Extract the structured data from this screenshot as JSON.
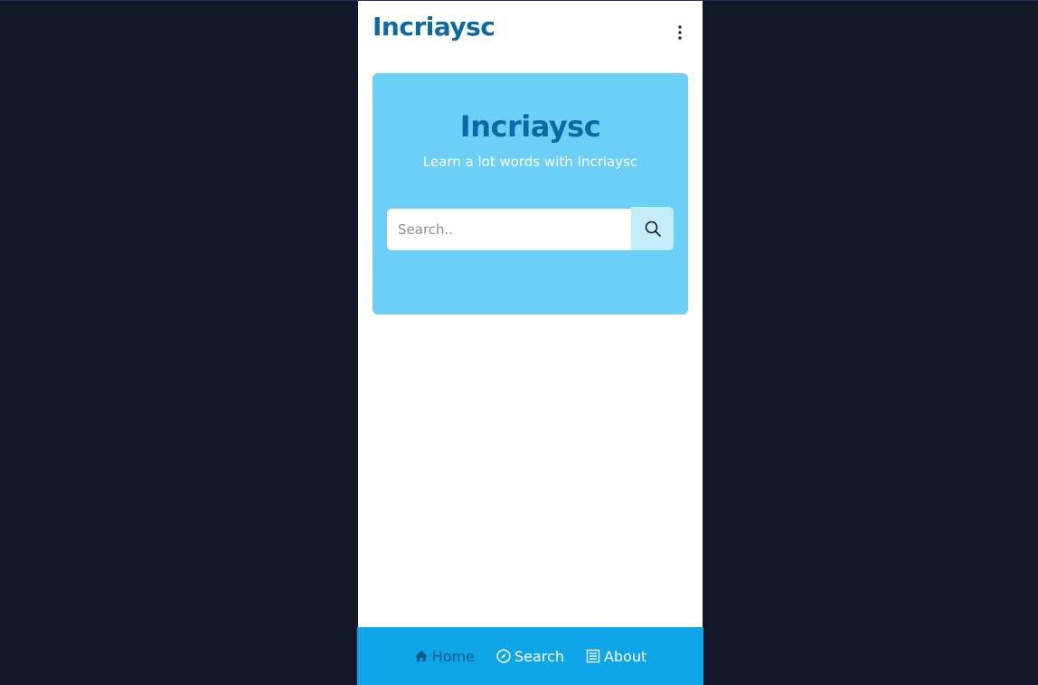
{
  "app": {
    "brand": "Incriaysc",
    "menu_icon": "more-vertical-icon"
  },
  "hero": {
    "title": "Incriaysc",
    "subtitle": "Learn a lot words with Incriaysc",
    "background_color": "#6bcff8",
    "title_color": "#0b6aa6"
  },
  "search": {
    "placeholder": "Search..",
    "value": "",
    "button_icon": "search-icon"
  },
  "bottom_nav": {
    "background_color": "#0ea5e9",
    "items": [
      {
        "label": "Home",
        "icon": "home-icon",
        "active": true
      },
      {
        "label": "Search",
        "icon": "compass-icon",
        "active": false
      },
      {
        "label": "About",
        "icon": "newspaper-icon",
        "active": false
      }
    ]
  }
}
